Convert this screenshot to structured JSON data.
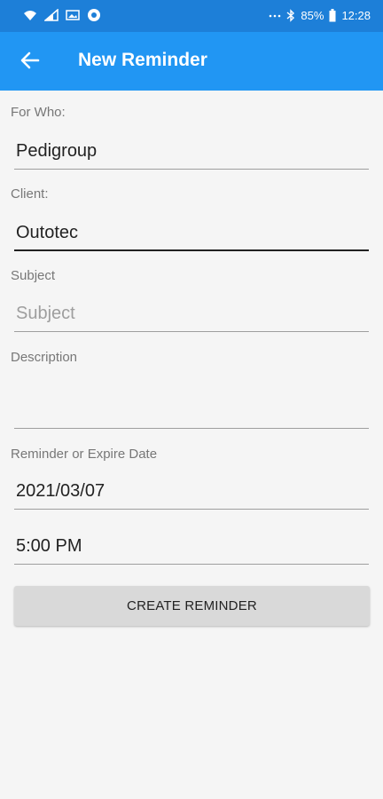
{
  "status_bar": {
    "battery": "85%",
    "time": "12:28",
    "icons": [
      "wifi-icon",
      "signal-icon",
      "image-icon",
      "chrome-icon",
      "more-icon",
      "bluetooth-icon",
      "battery-icon"
    ]
  },
  "app_bar": {
    "title": "New Reminder",
    "back_icon": "arrow-back-icon",
    "color": "#2196f3"
  },
  "form": {
    "for_who": {
      "label": "For Who:",
      "value": "Pedigroup"
    },
    "client": {
      "label": "Client:",
      "value": "Outotec"
    },
    "subject": {
      "label": "Subject",
      "value": "",
      "placeholder": "Subject"
    },
    "description": {
      "label": "Description",
      "value": ""
    },
    "reminder": {
      "label": "Reminder or Expire Date",
      "date": "2021/03/07",
      "time": "5:00 PM"
    },
    "create_button": "CREATE REMINDER"
  }
}
